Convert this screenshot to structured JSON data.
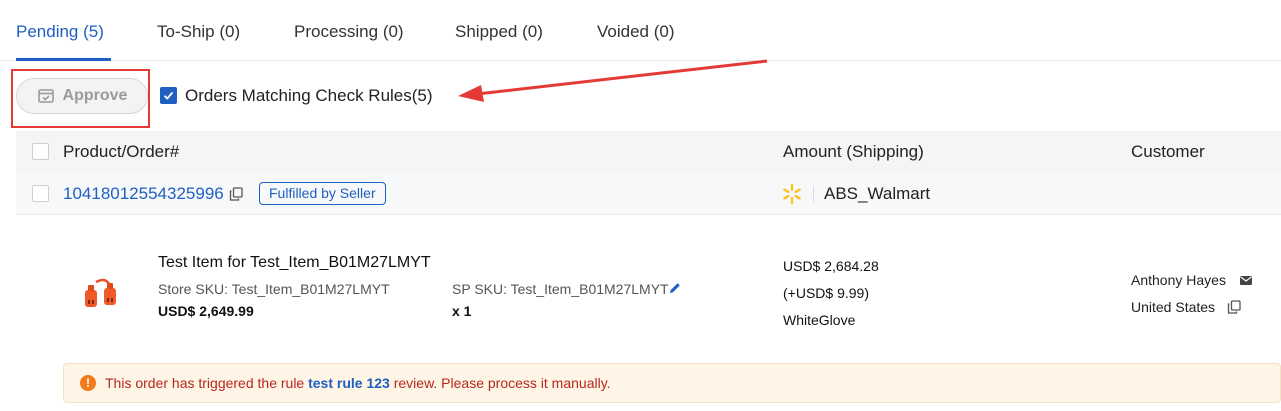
{
  "tabs": [
    {
      "label": "Pending (5)",
      "active": true
    },
    {
      "label": "To-Ship (0)",
      "active": false
    },
    {
      "label": "Processing (0)",
      "active": false
    },
    {
      "label": "Shipped (0)",
      "active": false
    },
    {
      "label": "Voided (0)",
      "active": false
    }
  ],
  "toolbar": {
    "approve_label": "Approve",
    "rule_filter_label": "Orders Matching Check Rules(5)",
    "rule_filter_checked": true
  },
  "table": {
    "headers": {
      "product": "Product/Order#",
      "amount": "Amount (Shipping)",
      "customer": "Customer"
    }
  },
  "order": {
    "id": "10418012554325996",
    "badge": "Fulfilled by Seller",
    "store": "ABS_Walmart",
    "item": {
      "title": "Test Item for Test_Item_B01M27LMYT",
      "store_sku": "Store SKU: Test_Item_B01M27LMYT",
      "sp_sku": "SP SKU: Test_Item_B01M27LMYT",
      "price": "USD$ 2,649.99",
      "qty": "x 1"
    },
    "amount": {
      "total": "USD$ 2,684.28",
      "shipping": "(+USD$ 9.99)",
      "method": "WhiteGlove"
    },
    "customer": {
      "name": "Anthony Hayes",
      "country": "United States"
    },
    "warning": {
      "prefix": "This order has triggered the rule",
      "rule": "test rule 123",
      "suffix": "review. Please process it manually."
    }
  },
  "colors": {
    "accent": "#1f5fc1",
    "highlight": "#e53935",
    "warning_bg": "#fff5e6",
    "warning_text": "#b7281c",
    "walmart_yellow": "#ffc220"
  }
}
